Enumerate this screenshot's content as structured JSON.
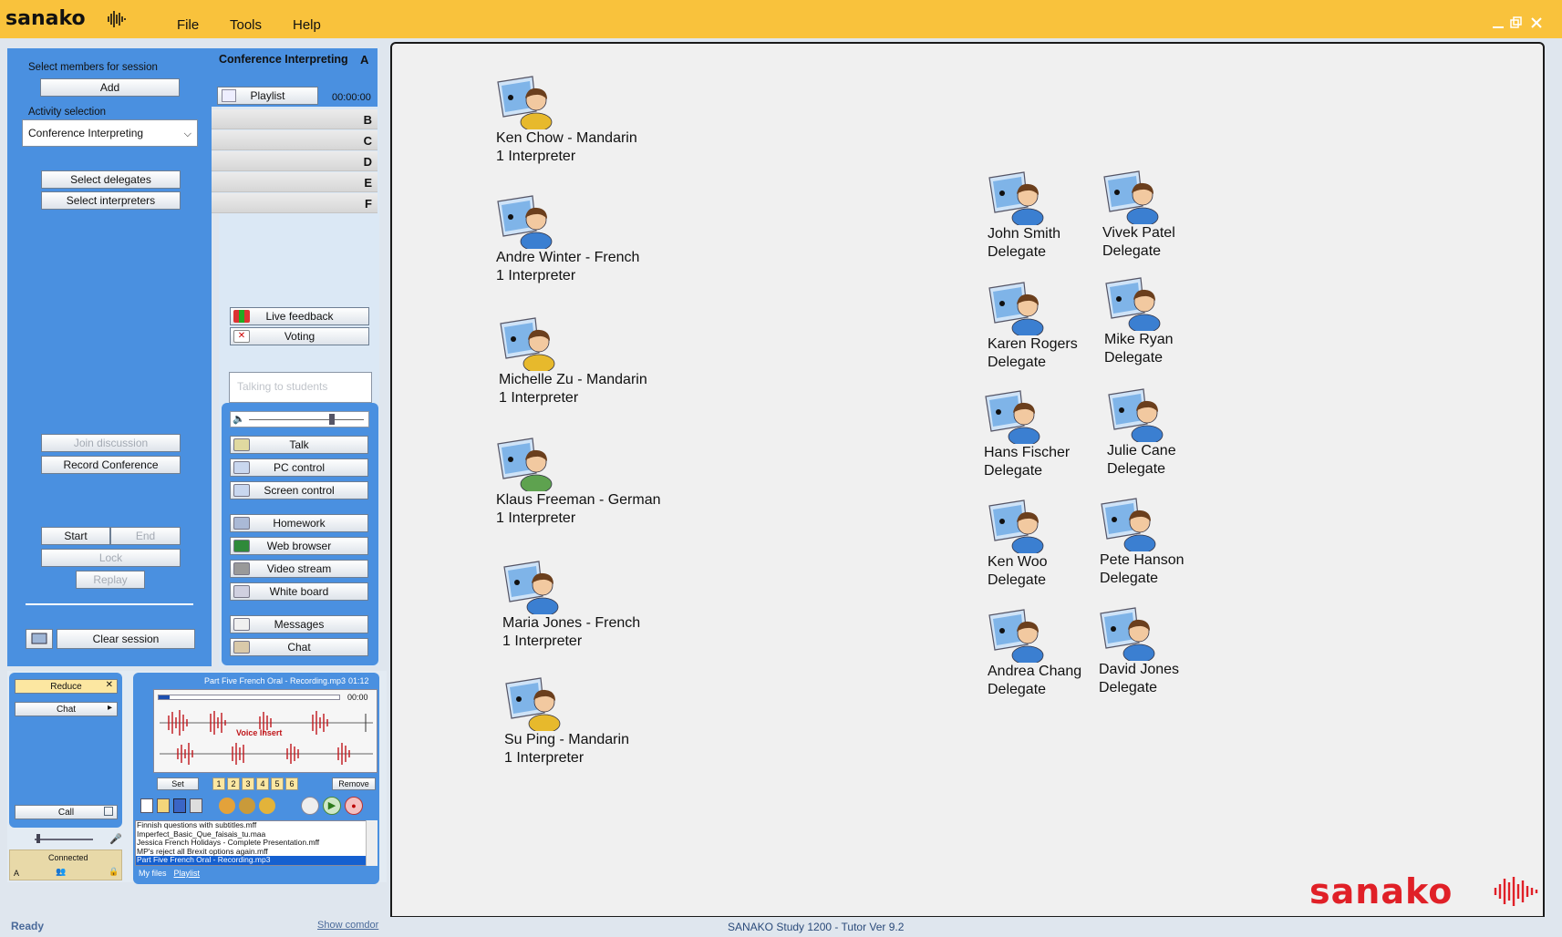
{
  "app": {
    "logo_text": "sanako",
    "menu": [
      "File",
      "Tools",
      "Help"
    ]
  },
  "left": {
    "select_members_label": "Select members for session",
    "add_label": "Add",
    "activity_label": "Activity selection",
    "activity_value": "Conference Interpreting",
    "select_delegates": "Select delegates",
    "select_interpreters": "Select interpreters",
    "join_discussion": "Join discussion",
    "record_conference": "Record Conference",
    "start": "Start",
    "end": "End",
    "lock": "Lock",
    "replay": "Replay",
    "clear_session": "Clear session"
  },
  "groups": {
    "title": "Conference Interpreting",
    "a": "A",
    "playlist": "Playlist",
    "time": "00:00:00",
    "rows": [
      "B",
      "C",
      "D",
      "E",
      "F"
    ]
  },
  "tools": {
    "live_feedback": "Live feedback",
    "voting": "Voting",
    "talking_placeholder": "Talking to students",
    "items": [
      "Talk",
      "PC control",
      "Screen control",
      "Homework",
      "Web browser",
      "Video stream",
      "White board",
      "Messages",
      "Chat"
    ]
  },
  "bottom": {
    "reduce": "Reduce",
    "chat": "Chat",
    "call": "Call",
    "connected": "Connected",
    "a": "A",
    "track_title": "Part Five French Oral - Recording.mp3",
    "track_time": "01:12",
    "position": "00:00",
    "voice_insert": "Voice Insert",
    "set": "Set",
    "remove": "Remove",
    "markers": [
      "1",
      "2",
      "3",
      "4",
      "5",
      "6"
    ],
    "files": [
      "Finnish questions with subtitles.mff",
      "Imperfect_Basic_Que_faisais_tu.maa",
      "Jessica French Holidays - Complete Presentation.mff",
      "MP's reject all Brexit options again.mff",
      "Part Five French Oral - Recording.mp3"
    ],
    "tab_myfiles": "My files",
    "tab_playlist": "Playlist"
  },
  "interpreters": [
    {
      "name": "Ken Chow - Mandarin",
      "role": "1  Interpreter",
      "face": "#e7b92c"
    },
    {
      "name": "Andre Winter - French",
      "role": "1  Interpreter",
      "face": "#3b7fd1"
    },
    {
      "name": "Michelle Zu - Mandarin",
      "role": "1  Interpreter",
      "face": "#e7b92c"
    },
    {
      "name": "Klaus Freeman - German",
      "role": "1  Interpreter",
      "face": "#5ea24f"
    },
    {
      "name": "Maria Jones - French",
      "role": "1  Interpreter",
      "face": "#3b7fd1"
    },
    {
      "name": "Su Ping - Mandarin",
      "role": "1  Interpreter",
      "face": "#e7b92c"
    }
  ],
  "delegates": [
    {
      "name": "John Smith",
      "role": "Delegate"
    },
    {
      "name": "Vivek Patel",
      "role": "Delegate"
    },
    {
      "name": "Karen Rogers",
      "role": "Delegate"
    },
    {
      "name": "Mike Ryan",
      "role": "Delegate"
    },
    {
      "name": "Hans Fischer",
      "role": "Delegate"
    },
    {
      "name": "Julie Cane",
      "role": "Delegate"
    },
    {
      "name": "Ken Woo",
      "role": "Delegate"
    },
    {
      "name": "Pete Hanson",
      "role": "Delegate"
    },
    {
      "name": "Andrea Chang",
      "role": "Delegate"
    },
    {
      "name": "David Jones",
      "role": "Delegate"
    }
  ],
  "status": {
    "ready": "Ready",
    "show_comdor": "Show comdor",
    "version": "SANAKO Study 1200 - Tutor  Ver 9.2"
  },
  "brand": "sanako"
}
